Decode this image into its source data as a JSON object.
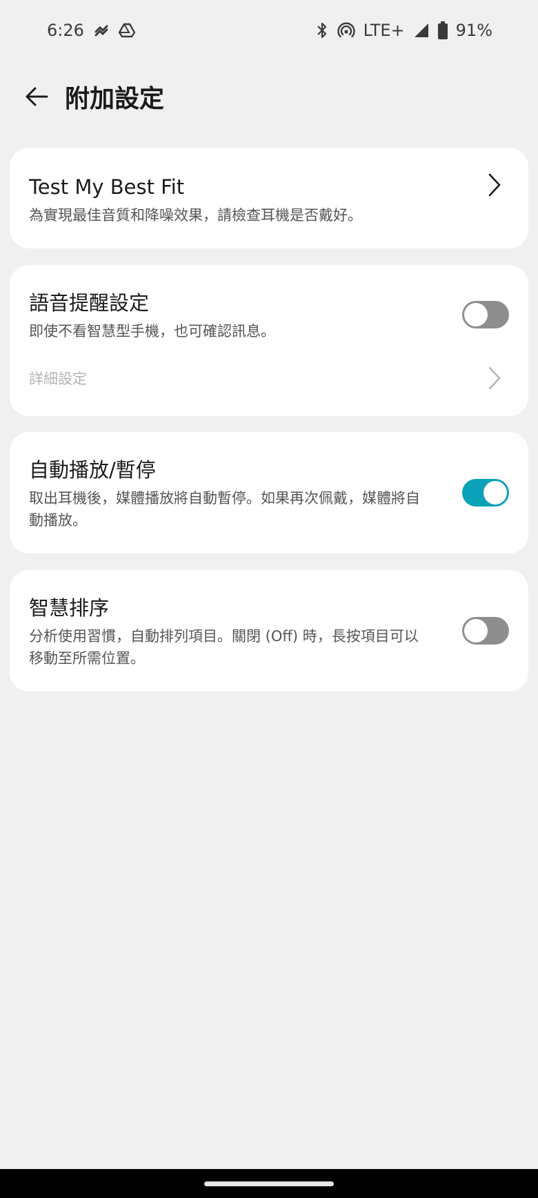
{
  "status_bar": {
    "time": "6:26",
    "network": "LTE+",
    "battery": "91%",
    "icons": [
      "link-icon",
      "drive-icon",
      "bluetooth-icon",
      "hotspot-icon",
      "signal-icon",
      "battery-icon"
    ]
  },
  "app_bar": {
    "title": "附加設定",
    "back_icon": "arrow-left-icon"
  },
  "cards": {
    "best_fit": {
      "title": "Test My Best Fit",
      "description": "為實現最佳音質和降噪效果，請檢查耳機是否戴好。"
    },
    "voice_notification": {
      "title": "語音提醒設定",
      "description": "即使不看智慧型手機，也可確認訊息。",
      "toggle_on": false,
      "detail_label": "詳細設定"
    },
    "auto_play": {
      "title": "自動播放/暫停",
      "description": "取出耳機後，媒體播放將自動暫停。如果再次佩戴，媒體將自動播放。",
      "toggle_on": true
    },
    "smart_sort": {
      "title": "智慧排序",
      "description": "分析使用習慣，自動排列項目。關閉 (Off) 時，長按項目可以移動至所需位置。",
      "toggle_on": false
    }
  },
  "colors": {
    "accent": "#0aa2b8",
    "toggle_off": "#8e8e8e",
    "background": "#f0f0f0",
    "card": "#ffffff"
  }
}
